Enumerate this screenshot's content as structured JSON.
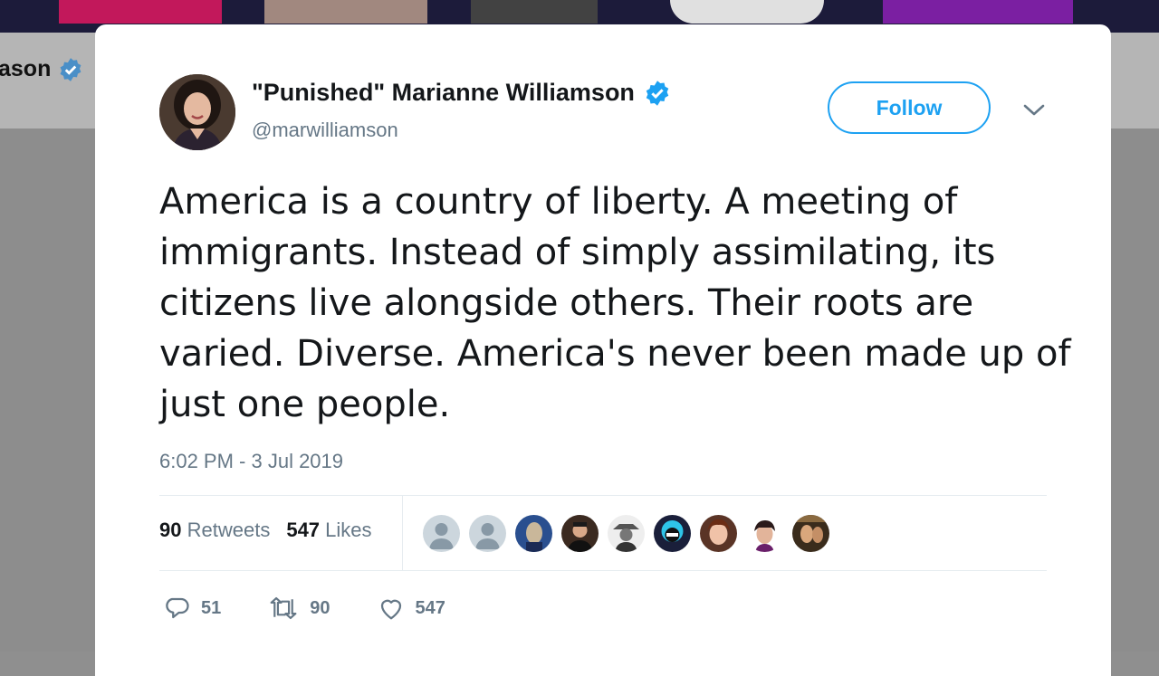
{
  "background": {
    "profile_name_fragment": "ason"
  },
  "tweet": {
    "display_name": "\"Punished\" Marianne Williamson",
    "handle": "@marwilliamson",
    "follow_label": "Follow",
    "text": "America is a country of liberty. A meeting of immigrants. Instead of simply assimilating, its citizens live alongside others. Their roots are varied. Diverse. America's never been made up of just one people.",
    "timestamp": "6:02 PM - 3 Jul 2019",
    "stats": {
      "retweets_count": "90",
      "retweets_label": "Retweets",
      "likes_count": "547",
      "likes_label": "Likes"
    },
    "actions": {
      "reply_count": "51",
      "retweet_count": "90",
      "like_count": "547"
    },
    "liker_avatars": 9
  },
  "icons": {
    "verified": "verified-badge-icon",
    "caret": "chevron-down-icon",
    "reply": "reply-icon",
    "retweet": "retweet-icon",
    "like": "heart-icon"
  },
  "colors": {
    "accent": "#1da1f2",
    "text": "#14171a",
    "muted": "#657786"
  }
}
